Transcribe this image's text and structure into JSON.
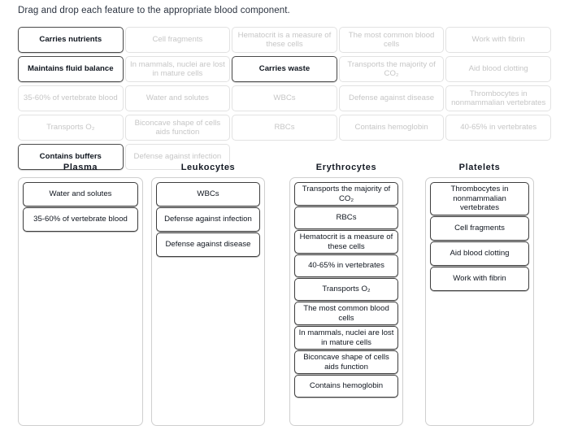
{
  "instruction": "Drag and drop each feature to the appropriate blood component.",
  "source_grid": {
    "columns": 5,
    "tiles": [
      {
        "label": "Carries nutrients",
        "state": "active"
      },
      {
        "label": "Cell fragments",
        "state": "used"
      },
      {
        "label": "Hematocrit is a measure of these cells",
        "state": "used"
      },
      {
        "label": "The most common blood cells",
        "state": "used"
      },
      {
        "label": "Work with fibrin",
        "state": "used"
      },
      {
        "label": "Maintains fluid balance",
        "state": "active"
      },
      {
        "label": "In mammals, nuclei are lost in mature cells",
        "state": "used"
      },
      {
        "label": "Carries waste",
        "state": "active"
      },
      {
        "label": "Transports the majority of CO₂",
        "state": "used"
      },
      {
        "label": "Aid blood clotting",
        "state": "used"
      },
      {
        "label": "35-60% of vertebrate blood",
        "state": "used"
      },
      {
        "label": "Water and solutes",
        "state": "used"
      },
      {
        "label": "WBCs",
        "state": "used"
      },
      {
        "label": "Defense against disease",
        "state": "used"
      },
      {
        "label": "Thrombocytes in nonmammalian vertebrates",
        "state": "used"
      },
      {
        "label": "Transports O₂",
        "state": "used"
      },
      {
        "label": "Biconcave shape of cells aids function",
        "state": "used"
      },
      {
        "label": "RBCs",
        "state": "used"
      },
      {
        "label": "Contains hemoglobin",
        "state": "used"
      },
      {
        "label": "40-65% in vertebrates",
        "state": "used"
      },
      {
        "label": "Contains buffers",
        "state": "active"
      },
      {
        "label": "Defense against infection",
        "state": "used"
      },
      {
        "label": "",
        "state": "empty"
      },
      {
        "label": "",
        "state": "empty"
      },
      {
        "label": "",
        "state": "empty"
      }
    ]
  },
  "zones": [
    {
      "title": "Plasma",
      "items": [
        {
          "label": "Water and solutes"
        },
        {
          "label": "35-60% of vertebrate blood"
        }
      ]
    },
    {
      "title": "Leukocytes",
      "items": [
        {
          "label": "WBCs"
        },
        {
          "label": "Defense against infection"
        },
        {
          "label": "Defense against disease"
        }
      ]
    },
    {
      "title": "Erythrocytes",
      "items": [
        {
          "label": "Transports the majority of CO₂"
        },
        {
          "label": "RBCs"
        },
        {
          "label": "Hematocrit is a measure of these cells"
        },
        {
          "label": "40-65% in vertebrates"
        },
        {
          "label": "Transports O₂"
        },
        {
          "label": "The most common blood cells"
        },
        {
          "label": "In mammals, nuclei are lost in mature cells"
        },
        {
          "label": "Biconcave shape of cells aids function"
        },
        {
          "label": "Contains hemoglobin"
        }
      ]
    },
    {
      "title": "Platelets",
      "items": [
        {
          "label": "Thrombocytes in nonmammalian vertebrates"
        },
        {
          "label": "Cell fragments"
        },
        {
          "label": "Aid blood clotting"
        },
        {
          "label": "Work with fibrin"
        }
      ]
    }
  ],
  "colors": {
    "active_border": "#4a4a4a",
    "used_border": "#e2e2e2",
    "used_text": "#c6c6c6",
    "zone_border": "#cfcfcf",
    "placed_border": "#3e3e3e",
    "text": "#10161f",
    "background": "#ffffff"
  }
}
